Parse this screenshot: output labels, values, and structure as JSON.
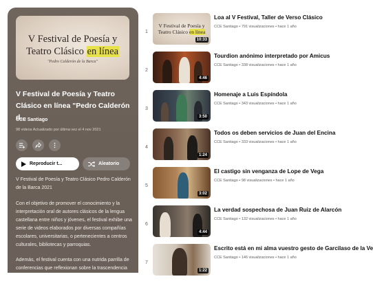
{
  "playlist": {
    "cover_line1": "V Festival de Poesía y",
    "cover_line2_a": "Teatro Clásico ",
    "cover_line2_b": "en línea",
    "cover_line3": "\"Pedro Calderón de la Barca\"",
    "title": "V Festival de Poesía y Teatro Clásico en línea \"Pedro Calderón d...",
    "channel": "CCE Santiago",
    "meta": "98 videos  Actualizado por última vez el 4 nov 2021",
    "play_label": "Reproducir t...",
    "shuffle_label": "Aleatorio",
    "desc1": "V Festival de Poesía y Teatro Clásico Pedro Calderón de la Barca 2021",
    "desc2": "Con el objetivo de promover el conocimiento y la interpretación oral de autores clásicos de la lengua castellana entre niños y jóvenes, el festival exhibe una serie de videos elaborados por diversas compañías escolares, universitarias, o pertenecientes a centros culturales, bibliotecas y parroquias.",
    "desc3": "Además, el festival cuenta con una nutrida parrilla de conferencias que reflexionan sobre la trascendencia de autores de la época, el lenguaje"
  },
  "videos": [
    {
      "index": "1",
      "title": "Loa al V Festival, Taller de Verso Clásico",
      "channel": "CCE Santiago",
      "views": "791 visualizaciones",
      "age": "hace 1 año",
      "duration": "10:33"
    },
    {
      "index": "2",
      "title": "Tourdion anónimo interpretado por Amicus",
      "channel": "CCE Santiago",
      "views": "338 visualizaciones",
      "age": "hace 1 año",
      "duration": "4:46"
    },
    {
      "index": "3",
      "title": "Homenaje a Luis Espíndola",
      "channel": "CCE Santiago",
      "views": "343 visualizaciones",
      "age": "hace 1 año",
      "duration": "3:50"
    },
    {
      "index": "4",
      "title": "Todos os deben servicios de Juan del Encina",
      "channel": "CCE Santiago",
      "views": "333 visualizaciones",
      "age": "hace 1 año",
      "duration": "1:24"
    },
    {
      "index": "5",
      "title": "El castigo sin venganza de Lope de Vega",
      "channel": "CCE Santiago",
      "views": "98 visualizaciones",
      "age": "hace 1 año",
      "duration": "3:02"
    },
    {
      "index": "6",
      "title": "La verdad sospechosa de Juan Ruiz de Alarcón",
      "channel": "CCE Santiago",
      "views": "132 visualizaciones",
      "age": "hace 1 año",
      "duration": "4:44"
    },
    {
      "index": "7",
      "title": "Escrito está en mi alma vuestro gesto de Garcilaso de la Vega",
      "channel": "CCE Santiago",
      "views": "146 visualizaciones",
      "age": "hace 1 año",
      "duration": "1:22"
    }
  ],
  "icons": {
    "save": "add-to-queue-icon",
    "share": "share-icon",
    "more": "more-vertical-icon",
    "play": "play-icon",
    "shuffle": "shuffle-icon"
  },
  "colors": {
    "panel": "#6b6059",
    "highlight": "#e8e24a",
    "duration_bg": "#000000"
  }
}
